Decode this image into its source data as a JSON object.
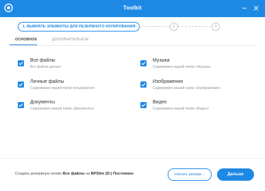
{
  "window": {
    "title": "Toolkit",
    "accent_color": "#1e88e5"
  },
  "steps": {
    "active_label": "1. ВЫБРАТЬ ЭЛЕМЕНТЫ ДЛЯ РЕЗЕРВНОГО КОПИРОВАНИЯ",
    "step2": "2",
    "step3": "3"
  },
  "tabs": {
    "basic": "ОСНОВНОЕ",
    "advanced": "ДОПОЛНИТЕЛЬНОЕ",
    "selected": "basic"
  },
  "items": [
    {
      "name": "Все файлы",
      "desc": "Все файлы данных",
      "checked": true
    },
    {
      "name": "Личные файлы",
      "desc": "Содержимое вашей папки пользователя",
      "checked": true
    },
    {
      "name": "Документы",
      "desc": "Содержимое вашей папки «Документы»",
      "checked": true
    },
    {
      "name": "Музыка",
      "desc": "Содержимое вашей папки «Музыка»",
      "checked": true
    },
    {
      "name": "Изображения",
      "desc": "Содержимое вашей папки «Изображения»",
      "checked": true
    },
    {
      "name": "Видео",
      "desc": "Содержимое вашей папки «Видео»",
      "checked": true
    }
  ],
  "footer": {
    "summary_prefix": "Создать резервную копию ",
    "summary_what": "Все файлы",
    "summary_mid": " на ",
    "summary_target": "BPSlim (D:) Постоянно",
    "settings_button": "Начать резерв...",
    "next_button": "Дальше"
  }
}
